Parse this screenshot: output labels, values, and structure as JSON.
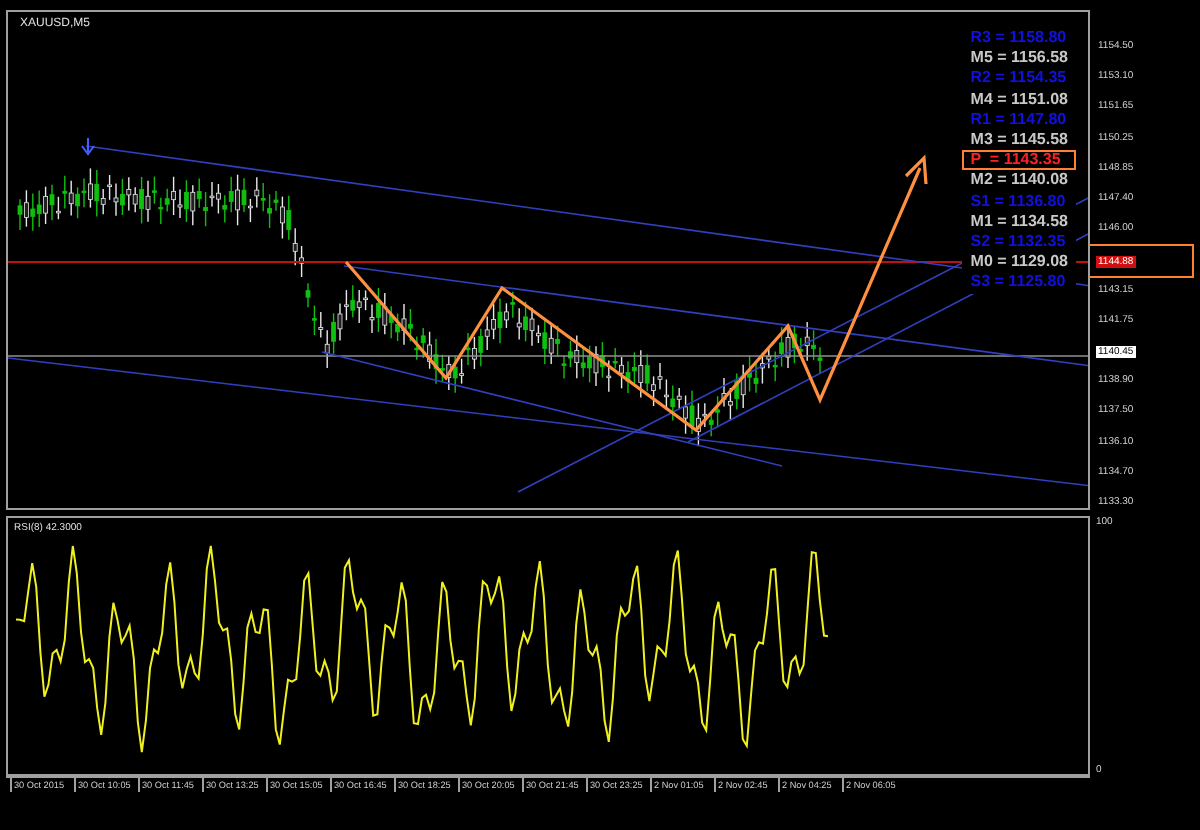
{
  "chart_title": "XAUUSD,M5",
  "pivot_levels": [
    {
      "label": "R3 = 1158.80",
      "kind": "resistance",
      "highlighted": false
    },
    {
      "label": "M5 = 1156.58",
      "kind": "mid",
      "highlighted": false
    },
    {
      "label": "R2 = 1154.35",
      "kind": "resistance",
      "highlighted": false
    },
    {
      "label": "M4 = 1151.08",
      "kind": "mid",
      "highlighted": false
    },
    {
      "label": "R1 = 1147.80",
      "kind": "resistance",
      "highlighted": false
    },
    {
      "label": "M3 = 1145.58",
      "kind": "mid",
      "highlighted": false
    },
    {
      "label": "P  = 1143.35",
      "kind": "pivot",
      "highlighted": true
    },
    {
      "label": "M2 = 1140.08",
      "kind": "mid",
      "highlighted": false
    },
    {
      "label": "S1 = 1136.80",
      "kind": "support",
      "highlighted": false
    },
    {
      "label": "M1 = 1134.58",
      "kind": "mid",
      "highlighted": false
    },
    {
      "label": "S2 = 1132.35",
      "kind": "support",
      "highlighted": false
    },
    {
      "label": "M0 = 1129.08",
      "kind": "mid",
      "highlighted": false
    },
    {
      "label": "S3 = 1125.80",
      "kind": "support",
      "highlighted": false
    }
  ],
  "price_axis": [
    "1154.50",
    "1153.10",
    "1151.65",
    "1150.25",
    "1148.85",
    "1147.40",
    "1146.00",
    "1143.15",
    "1141.75",
    "1138.90",
    "1137.50",
    "1136.10",
    "1134.70",
    "1133.30"
  ],
  "line_label": "1144.88",
  "current_price": "1140.45",
  "rsi": {
    "label": "RSI(8) 42.3000",
    "scale_max": "100",
    "scale_min": "0"
  },
  "time_axis": [
    "30 Oct 2015",
    "30 Oct 10:05",
    "30 Oct 11:45",
    "30 Oct 13:25",
    "30 Oct 15:05",
    "30 Oct 16:45",
    "30 Oct 18:25",
    "30 Oct 20:05",
    "30 Oct 21:45",
    "30 Oct 23:25",
    "2 Nov 01:05",
    "2 Nov 02:45",
    "2 Nov 04:25",
    "2 Nov 06:05"
  ]
}
